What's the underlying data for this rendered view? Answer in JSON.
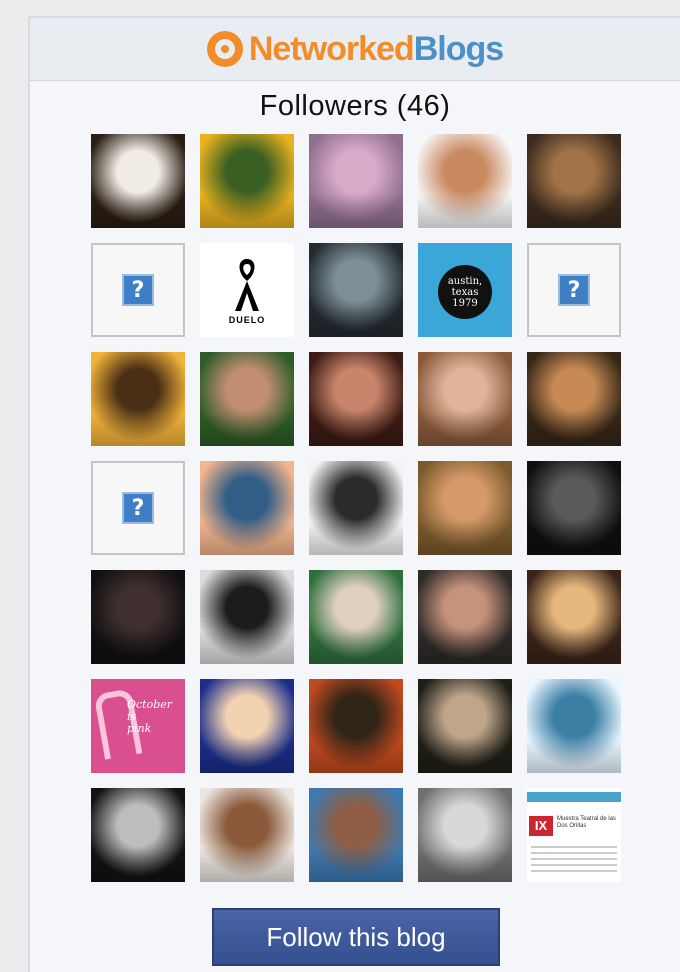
{
  "brand": {
    "logo_part1": "Networked",
    "logo_part2": "Blogs"
  },
  "title": "Followers (46)",
  "follow_button": "Follow this blog",
  "colors": {
    "brand_orange": "#f28c28",
    "brand_blue": "#4b90c8",
    "button_blue": "#3d5799"
  },
  "followers": [
    {
      "kind": "photo",
      "c1": "#2a1d12",
      "c2": "#f1ede6"
    },
    {
      "kind": "photo",
      "c1": "#e9b21f",
      "c2": "#3a5f22"
    },
    {
      "kind": "photo",
      "c1": "#8f6f90",
      "c2": "#d9a9c8"
    },
    {
      "kind": "photo",
      "c1": "#f7f7f7",
      "c2": "#c98a60"
    },
    {
      "kind": "photo",
      "c1": "#3b2a1f",
      "c2": "#a17346"
    },
    {
      "kind": "missing",
      "icon": "?"
    },
    {
      "kind": "ribbon",
      "caption": "DUELO"
    },
    {
      "kind": "photo",
      "c1": "#232a2f",
      "c2": "#7e8f97"
    },
    {
      "kind": "austin",
      "lines": [
        "austin,",
        "texas",
        "1979"
      ]
    },
    {
      "kind": "missing",
      "icon": "?"
    },
    {
      "kind": "photo",
      "c1": "#f2b33a",
      "c2": "#4a2e16"
    },
    {
      "kind": "photo",
      "c1": "#2c5c27",
      "c2": "#c28d72"
    },
    {
      "kind": "photo",
      "c1": "#3d1a14",
      "c2": "#c9856b"
    },
    {
      "kind": "photo",
      "c1": "#8a5a3a",
      "c2": "#e0b39a"
    },
    {
      "kind": "photo",
      "c1": "#352617",
      "c2": "#c78a54"
    },
    {
      "kind": "missing",
      "icon": "?"
    },
    {
      "kind": "photo",
      "c1": "#f3b58d",
      "c2": "#315d86"
    },
    {
      "kind": "photo",
      "c1": "#f2f2f2",
      "c2": "#2b2b2b"
    },
    {
      "kind": "photo",
      "c1": "#7b5a2b",
      "c2": "#d69a6a"
    },
    {
      "kind": "photo",
      "c1": "#0f0f0f",
      "c2": "#5a5a5a"
    },
    {
      "kind": "photo",
      "c1": "#101010",
      "c2": "#3f2f2f"
    },
    {
      "kind": "photo",
      "c1": "#dcdcdc",
      "c2": "#1c1c1c"
    },
    {
      "kind": "photo",
      "c1": "#2e6f3d",
      "c2": "#dfd0bf"
    },
    {
      "kind": "photo",
      "c1": "#2d2a28",
      "c2": "#c5927b"
    },
    {
      "kind": "photo",
      "c1": "#3a2418",
      "c2": "#e6b77c"
    },
    {
      "kind": "pink",
      "text": [
        "October",
        "is",
        "pink"
      ]
    },
    {
      "kind": "photo",
      "c1": "#1b2e8a",
      "c2": "#f3d2b2"
    },
    {
      "kind": "photo",
      "c1": "#c24a1f",
      "c2": "#2e2418"
    },
    {
      "kind": "photo",
      "c1": "#1f1f17",
      "c2": "#bfa68b"
    },
    {
      "kind": "photo",
      "c1": "#e9f6ff",
      "c2": "#3b7fa5"
    },
    {
      "kind": "photo",
      "c1": "#121212",
      "c2": "#bdbdbd"
    },
    {
      "kind": "photo",
      "c1": "#ece6e0",
      "c2": "#8a5a3a"
    },
    {
      "kind": "photo",
      "c1": "#3c7ab3",
      "c2": "#8d5e45"
    },
    {
      "kind": "photo",
      "c1": "#6f6f6f",
      "c2": "#d8d8d8"
    },
    {
      "kind": "festival",
      "badge": "IX",
      "text": "Muestra Teatral de las Dos Orillas"
    }
  ]
}
